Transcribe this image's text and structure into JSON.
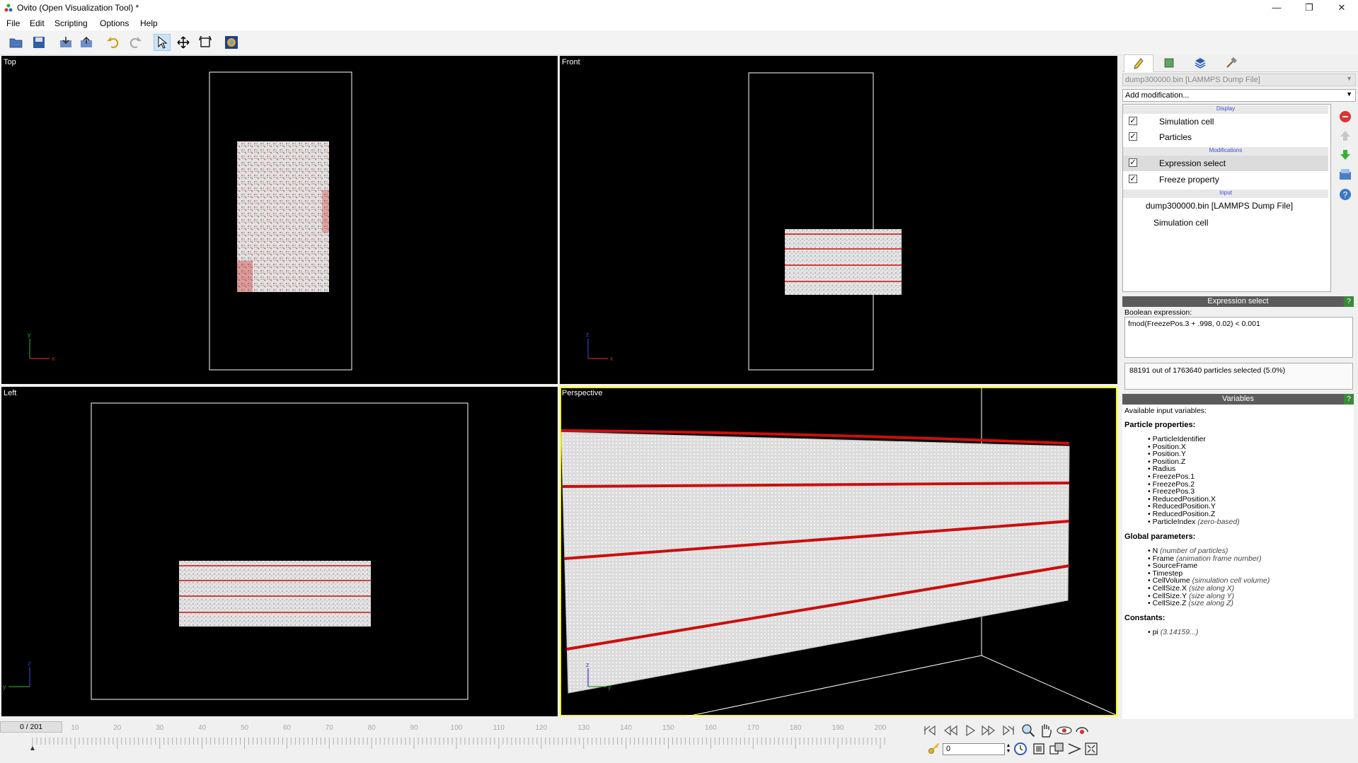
{
  "window": {
    "title": "Ovito (Open Visualization Tool) *",
    "minimize": "—",
    "maximize": "❐",
    "close": "✕"
  },
  "menu": [
    "File",
    "Edit",
    "Scripting",
    "Options",
    "Help"
  ],
  "viewports": {
    "top": {
      "label": "Top",
      "axis_v": "y",
      "axis_h": "x"
    },
    "front": {
      "label": "Front",
      "axis_v": "z",
      "axis_h": "x"
    },
    "left": {
      "label": "Left",
      "axis_v": "z",
      "axis_h": "y"
    },
    "perspective": {
      "label": "Perspective",
      "axis_v": "z",
      "axis_h": "y"
    }
  },
  "pipeline": {
    "source_select": "dump300000.bin [LAMMPS Dump File]",
    "add_modification": "Add modification...",
    "cat_display": "Display",
    "display_items": [
      "Simulation cell",
      "Particles"
    ],
    "cat_modifications": "Modifications",
    "modifier_items": [
      "Expression select",
      "Freeze property"
    ],
    "cat_input": "Input",
    "input_file": "dump300000.bin [LAMMPS Dump File]",
    "input_sub": "Simulation cell"
  },
  "expression_select": {
    "header": "Expression select",
    "help": "?",
    "bool_label": "Boolean expression:",
    "expression": "fmod(FreezePos.3 + .998, 0.02) < 0.001",
    "status": "88191 out of 1763640 particles selected (5.0%)"
  },
  "variables": {
    "header": "Variables",
    "help": "?",
    "available": "Available input variables:",
    "particle_heading": "Particle properties:",
    "particle_props": [
      {
        "name": "ParticleIdentifier",
        "note": ""
      },
      {
        "name": "Position.X",
        "note": ""
      },
      {
        "name": "Position.Y",
        "note": ""
      },
      {
        "name": "Position.Z",
        "note": ""
      },
      {
        "name": "Radius",
        "note": ""
      },
      {
        "name": "FreezePos.1",
        "note": ""
      },
      {
        "name": "FreezePos.2",
        "note": ""
      },
      {
        "name": "FreezePos.3",
        "note": ""
      },
      {
        "name": "ReducedPosition.X",
        "note": ""
      },
      {
        "name": "ReducedPosition.Y",
        "note": ""
      },
      {
        "name": "ReducedPosition.Z",
        "note": ""
      },
      {
        "name": "ParticleIndex",
        "note": "(zero-based)"
      }
    ],
    "global_heading": "Global parameters:",
    "global_params": [
      {
        "name": "N",
        "note": "(number of particles)"
      },
      {
        "name": "Frame",
        "note": "(animation frame number)"
      },
      {
        "name": "SourceFrame",
        "note": ""
      },
      {
        "name": "Timestep",
        "note": ""
      },
      {
        "name": "CellVolume",
        "note": "(simulation cell volume)"
      },
      {
        "name": "CellSize.X",
        "note": "(size along X)"
      },
      {
        "name": "CellSize.Y",
        "note": "(size along Y)"
      },
      {
        "name": "CellSize.Z",
        "note": "(size along Z)"
      }
    ],
    "constants_heading": "Constants:",
    "constants": [
      {
        "name": "pi",
        "note": "(3.14159...)"
      }
    ]
  },
  "timeline": {
    "frame_display": "0 / 201",
    "tick_labels": [
      "10",
      "20",
      "30",
      "40",
      "50",
      "60",
      "70",
      "80",
      "90",
      "100",
      "110",
      "120",
      "130",
      "140",
      "150",
      "160",
      "170",
      "180",
      "190",
      "200"
    ],
    "spinner_value": "0"
  },
  "colors": {
    "highlight": "#ffff00",
    "particle_red": "#cc0000",
    "particle_white": "#e6e6e6"
  }
}
